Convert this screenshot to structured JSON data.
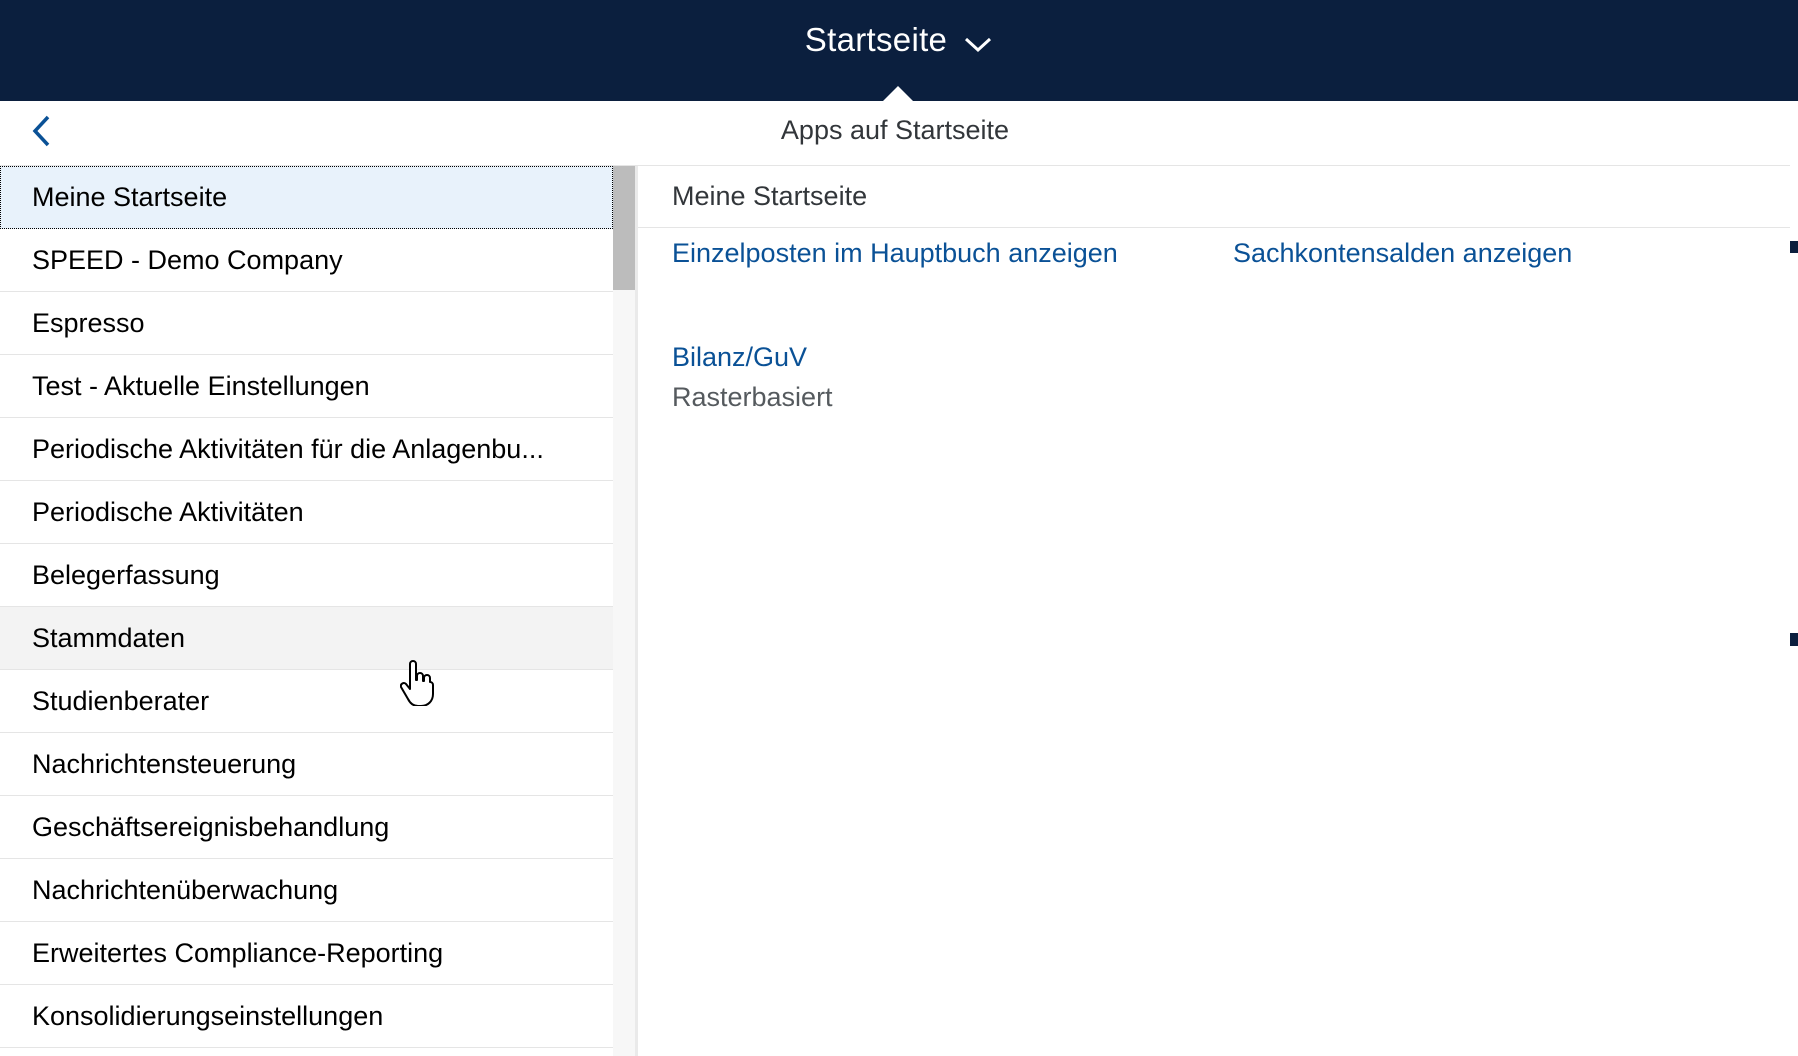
{
  "shell": {
    "title": "Startseite",
    "dropdown_icon": "chevron-down-icon"
  },
  "popover": {
    "title": "Apps auf Startseite",
    "back_icon": "chevron-left-icon"
  },
  "groups": [
    {
      "label": "Meine Startseite",
      "state": "selected"
    },
    {
      "label": "SPEED - Demo Company",
      "state": "normal"
    },
    {
      "label": "Espresso",
      "state": "normal"
    },
    {
      "label": "Test - Aktuelle Einstellungen",
      "state": "normal"
    },
    {
      "label": "Periodische Aktivitäten für die Anlagenbu...",
      "state": "normal"
    },
    {
      "label": "Periodische Aktivitäten",
      "state": "normal"
    },
    {
      "label": "Belegerfassung",
      "state": "normal"
    },
    {
      "label": "Stammdaten",
      "state": "hover"
    },
    {
      "label": "Studienberater",
      "state": "normal"
    },
    {
      "label": "Nachrichtensteuerung",
      "state": "normal"
    },
    {
      "label": "Geschäftsereignisbehandlung",
      "state": "normal"
    },
    {
      "label": "Nachrichtenüberwachung",
      "state": "normal"
    },
    {
      "label": "Erweitertes Compliance-Reporting",
      "state": "normal"
    },
    {
      "label": "Konsolidierungseinstellungen",
      "state": "normal"
    }
  ],
  "detail": {
    "heading": "Meine Startseite",
    "apps": [
      {
        "title": "Einzelposten im Hauptbuch anzeigen",
        "subtitle": ""
      },
      {
        "title": "Sachkontensalden anzeigen",
        "subtitle": ""
      },
      {
        "title": "Bilanz/GuV",
        "subtitle": "Rasterbasiert"
      }
    ]
  },
  "colors": {
    "shell_bg": "#0b1f3e",
    "link": "#0a5196",
    "selected_bg": "#e8f2fb",
    "hover_bg": "#f3f3f3"
  }
}
